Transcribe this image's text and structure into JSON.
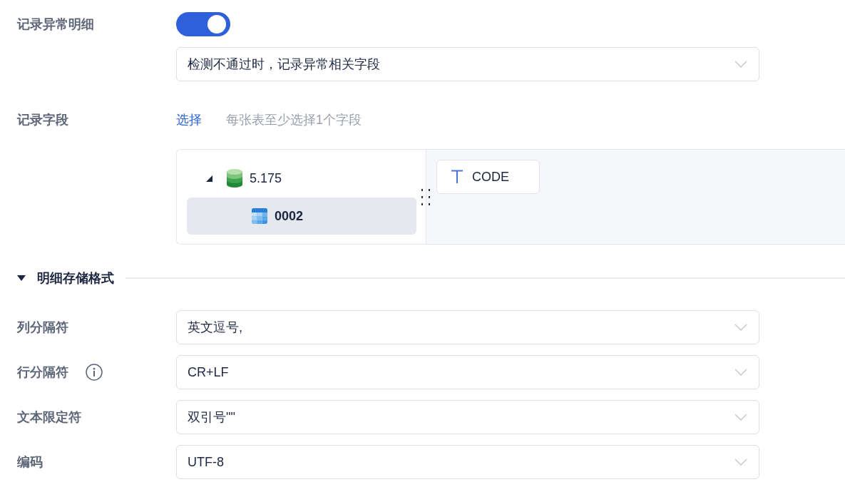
{
  "exception_details": {
    "label": "记录异常明细",
    "on": true,
    "dropdown": {
      "value": "检测不通过时，记录异常相关字段"
    }
  },
  "record_fields": {
    "label": "记录字段",
    "link": "选择",
    "hint": "每张表至少选择1个字段",
    "tree": [
      {
        "kind": "database",
        "label": "5.175",
        "expanded": true,
        "selected": false,
        "children": [
          {
            "kind": "table",
            "label": "0002",
            "selected": true
          }
        ]
      }
    ],
    "fields": [
      {
        "kind": "text",
        "label": "CODE"
      }
    ]
  },
  "storage_format": {
    "title": "明细存储格式",
    "expanded": true,
    "rows": [
      {
        "label": "列分隔符",
        "has_info": false,
        "value": "英文逗号,"
      },
      {
        "label": "行分隔符",
        "has_info": true,
        "value": "CR+LF"
      },
      {
        "label": "文本限定符",
        "has_info": false,
        "value": "双引号\"\""
      },
      {
        "label": "编码",
        "has_info": false,
        "value": "UTF-8"
      }
    ]
  }
}
